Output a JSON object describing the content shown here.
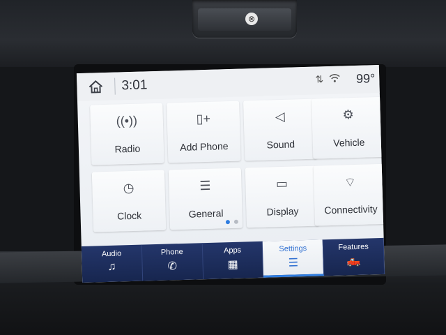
{
  "statusbar": {
    "time": "3:01",
    "temperature": "99°",
    "icons": [
      "home-icon",
      "sync-arrows-icon",
      "wifi-icon"
    ]
  },
  "tiles": [
    {
      "label": "Radio",
      "icon": "radio-antenna-icon",
      "glyph": "((•))"
    },
    {
      "label": "Add Phone",
      "icon": "add-phone-icon",
      "glyph": "▯+"
    },
    {
      "label": "Sound",
      "icon": "speaker-icon",
      "glyph": "◁"
    },
    {
      "label": "Vehicle",
      "icon": "vehicle-settings-icon",
      "glyph": "⚙"
    },
    {
      "label": "Clock",
      "icon": "clock-icon",
      "glyph": "◷"
    },
    {
      "label": "General",
      "icon": "sliders-icon",
      "glyph": "☰"
    },
    {
      "label": "Display",
      "icon": "display-icon",
      "glyph": "▭"
    },
    {
      "label": "Connectivity",
      "icon": "wifi-icon",
      "glyph": "⌔"
    }
  ],
  "pager": {
    "pages": 2,
    "active": 1
  },
  "bottom_nav": [
    {
      "label": "Audio",
      "icon": "music-note-icon",
      "glyph": "♫"
    },
    {
      "label": "Phone",
      "icon": "phone-icon",
      "glyph": "✆"
    },
    {
      "label": "Apps",
      "icon": "apps-grid-icon",
      "glyph": "▦"
    },
    {
      "label": "Settings",
      "icon": "settings-sliders-icon",
      "glyph": "☰",
      "active": true
    },
    {
      "label": "Features",
      "icon": "truck-icon",
      "glyph": "🛻"
    }
  ],
  "colors": {
    "accent": "#2f7de0",
    "nav_bg": "#1d2d5c",
    "screen_bg": "#eef1f5"
  }
}
